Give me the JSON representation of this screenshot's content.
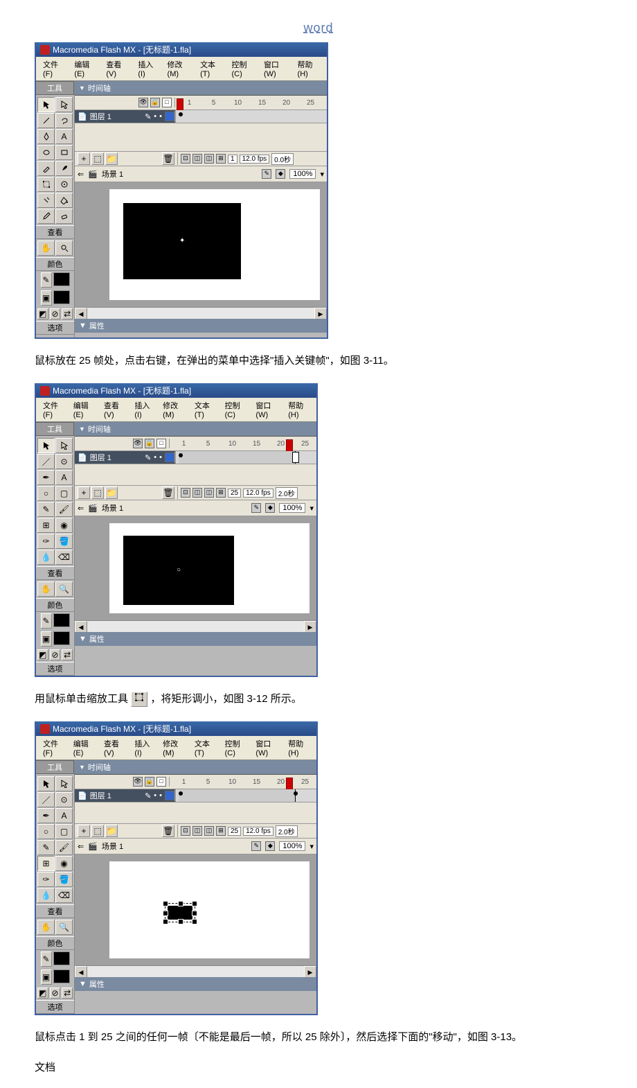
{
  "header": "word",
  "para1": "鼠标放在 25 帧处，点击右键，在弹出的菜单中选择\"插入关键帧\"，如图 3-11。",
  "para2_a": "用鼠标单击缩放工具",
  "para2_b": "，将矩形调小，如图 3-12 所示。",
  "para3": "鼠标点击 1 到 25 之间的任何一帧〔不能是最后一帧，所以 25 除外〕，然后选择下面的\"移动\"，如图 3-13。",
  "footer": "文档",
  "app": {
    "title": "Macromedia Flash MX - [无标题-1.fla]",
    "menus": [
      "文件(F)",
      "编辑(E)",
      "查看(V)",
      "插入(I)",
      "修改(M)",
      "文本(T)",
      "控制(C)",
      "窗口(W)",
      "帮助(H)"
    ],
    "tools_label": "工具",
    "view_label": "查看",
    "color_label": "颜色",
    "options_label": "选项",
    "timeline_label": "时间轴",
    "props_label": "属性",
    "layer_name": "图层 1",
    "scene_name": "场景 1",
    "zoom": "100%",
    "ruler_ticks": [
      "1",
      "5",
      "10",
      "15",
      "20",
      "25"
    ],
    "frame1": {
      "cur": "1",
      "fps": "12.0 fps",
      "time": "0.0秒"
    },
    "frame25": {
      "cur": "25",
      "fps": "12.0 fps",
      "time": "2.0秒"
    }
  }
}
